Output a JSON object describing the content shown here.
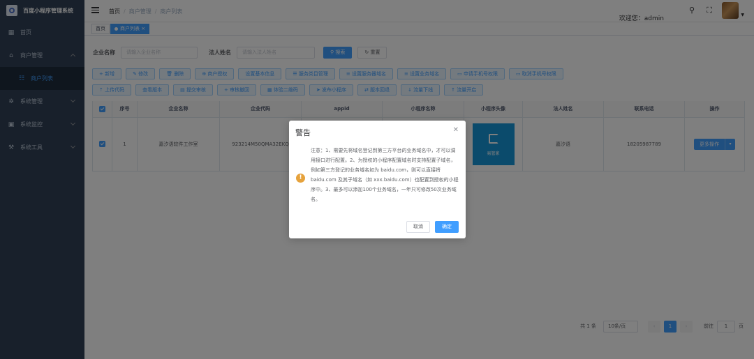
{
  "app": {
    "title": "百度小程序管理系统"
  },
  "sidebar": {
    "items": [
      {
        "label": "首页",
        "icon": "dashboard-icon"
      },
      {
        "label": "商户管理",
        "icon": "shop-icon"
      },
      {
        "label": "商户列表",
        "icon": "list-icon"
      },
      {
        "label": "系统管理",
        "icon": "gear-icon"
      },
      {
        "label": "系统监控",
        "icon": "monitor-icon"
      },
      {
        "label": "系统工具",
        "icon": "tool-icon"
      }
    ]
  },
  "navbar": {
    "breadcrumb": [
      "首页",
      "商户管理",
      "商户列表"
    ],
    "welcome": "欢迎您：admin"
  },
  "tags": {
    "items": [
      "首页",
      "商户列表"
    ]
  },
  "search": {
    "company_label": "企业名称",
    "company_placeholder": "请输入企业名称",
    "legal_label": "法人姓名",
    "legal_placeholder": "请输入法人姓名",
    "search_btn": "搜索",
    "reset_btn": "重置"
  },
  "toolbar": {
    "row1": [
      "新增",
      "修改",
      "删除",
      "商户授权",
      "设置基本信息",
      "服务类目管理",
      "设置服务器域名",
      "设置业务域名",
      "申请手机号权限",
      "取消手机号权限"
    ],
    "row2": [
      "上传代码",
      "查看版本",
      "提交审核",
      "审核撤回",
      "体验二维码",
      "发布小程序",
      "版本回退",
      "流量下线",
      "流量开启"
    ]
  },
  "table": {
    "headers": [
      "序号",
      "企业名称",
      "企业代码",
      "appid",
      "小程序名称",
      "小程序头像",
      "法人姓名",
      "联系电话",
      "操作"
    ],
    "rows": [
      {
        "index": "1",
        "company": "嘉汐语软件工作室",
        "code": "923214M50QMA32EKQ",
        "appid": "",
        "app_name": "",
        "app_avatar_text": "易管家",
        "legal": "嘉汐语",
        "phone": "18205987789",
        "action": "更多操作"
      }
    ]
  },
  "pagination": {
    "total": "共 1 条",
    "page_size": "10条/页",
    "current": "1",
    "goto_label": "前往",
    "goto_value": "1",
    "page_suffix": "页"
  },
  "dialog": {
    "title": "警告",
    "message": "注意：1、需要先将域名登记到第三方平台的业务域名中，才可以调用接口进行配置。2、为授权的小程序配置域名时支持配置子域名，例如第三方登记的业务域名如为 baidu.com，则可以直接将 baidu.com 及其子域名（如 xxx.baidu.com）也配置到授权的小程序中。3、最多可以添加100个业务域名，一年只可修改50次业务域名。",
    "cancel": "取消",
    "confirm": "确定"
  },
  "colors": {
    "primary": "#409eff",
    "sidebar_bg": "#304156",
    "warning": "#e6a23c"
  }
}
